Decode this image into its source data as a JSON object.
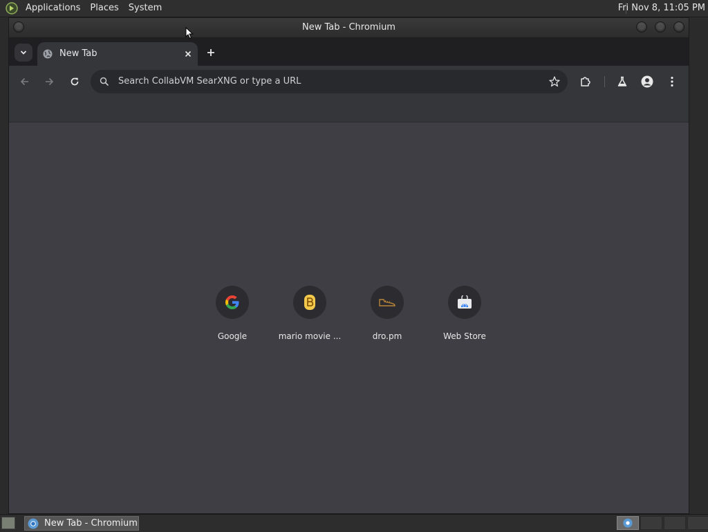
{
  "top_panel": {
    "menus": [
      "Applications",
      "Places",
      "System"
    ],
    "clock": "Fri Nov  8, 11:05 PM"
  },
  "window": {
    "title": "New Tab - Chromium"
  },
  "tabs": [
    {
      "title": "New Tab",
      "active": true
    }
  ],
  "toolbar": {
    "omnibox_placeholder": "Search CollabVM SearXNG or type a URL"
  },
  "shortcuts": [
    {
      "label": "Google",
      "icon": "google-icon"
    },
    {
      "label": "mario movie ...",
      "icon": "bootstrap-b-icon"
    },
    {
      "label": "dro.pm",
      "icon": "shoe-icon"
    },
    {
      "label": "Web Store",
      "icon": "web-store-icon"
    }
  ],
  "taskbar": {
    "tasks": [
      {
        "label": "New Tab - Chromium",
        "icon": "chromium-icon"
      }
    ]
  },
  "colors": {
    "content_bg": "#3e3e44",
    "toolbar_bg": "#35363a",
    "tabstrip_bg": "#1f1f22"
  }
}
